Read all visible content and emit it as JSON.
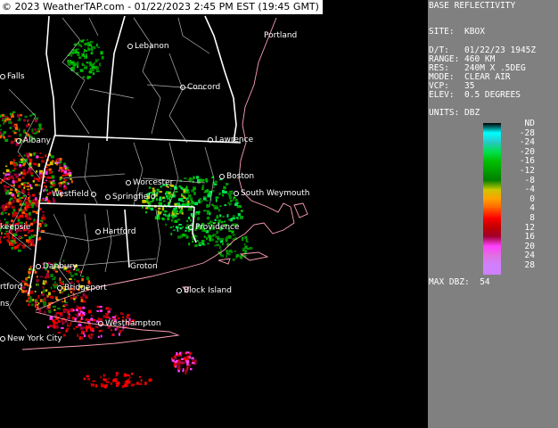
{
  "caption": "© 2023 WeatherTAP.com - 01/22/2023  2:45 PM EST (19:45 GMT)",
  "panel": {
    "title": "BASE REFLECTIVITY",
    "site": "SITE:  KBOX",
    "date": "D/T:   01/22/23 1945Z",
    "range": "RANGE: 460 KM",
    "res": "RES:   240M X .5DEG",
    "mode": "MODE:  CLEAR AIR",
    "vcp": "VCP:   35",
    "elev": "ELEV:  0.5 DEGREES",
    "units": "UNITS: DBZ",
    "max": "MAX DBZ:  54"
  },
  "legend": {
    "labels": [
      "ND",
      "-28",
      "-24",
      "-20",
      "-16",
      "-12",
      "-8",
      "-4",
      "0",
      "4",
      "8",
      "12",
      "16",
      "20",
      "24",
      "28"
    ],
    "colors": [
      "#000000",
      "#00ffff",
      "#28c8c8",
      "#00e050",
      "#00c000",
      "#00a000",
      "#008000",
      "#c8c800",
      "#ffa000",
      "#ff6000",
      "#ff0000",
      "#c00000",
      "#a00030",
      "#ff40ff",
      "#e070e0",
      "#d080ff"
    ]
  },
  "cities": [
    {
      "name": "Lebanon",
      "id": "lebanon"
    },
    {
      "name": "Portland",
      "id": "portland"
    },
    {
      "name": "Falls",
      "id": "falls"
    },
    {
      "name": "Concord",
      "id": "concord"
    },
    {
      "name": "Albany",
      "id": "albany"
    },
    {
      "name": "Lawrence",
      "id": "lawrence"
    },
    {
      "name": "Worcester",
      "id": "worcester"
    },
    {
      "name": "Boston",
      "id": "boston"
    },
    {
      "name": "Westfield",
      "id": "westfield"
    },
    {
      "name": "Springfield",
      "id": "springfield"
    },
    {
      "name": "South Weymouth",
      "id": "south-weymouth"
    },
    {
      "name": "Hartford",
      "id": "hartford"
    },
    {
      "name": "Providence",
      "id": "providence"
    },
    {
      "name": "keepsie",
      "id": "poughkeepsie"
    },
    {
      "name": "Danbury",
      "id": "danbury"
    },
    {
      "name": "Groton",
      "id": "groton"
    },
    {
      "name": "Block Island",
      "id": "block-island"
    },
    {
      "name": "rtford",
      "id": "stratford"
    },
    {
      "name": "Bridgeport",
      "id": "bridgeport"
    },
    {
      "name": "ns",
      "id": "white-plains"
    },
    {
      "name": "Westhampton",
      "id": "westhampton"
    },
    {
      "name": "New York City",
      "id": "new-york-city"
    }
  ]
}
